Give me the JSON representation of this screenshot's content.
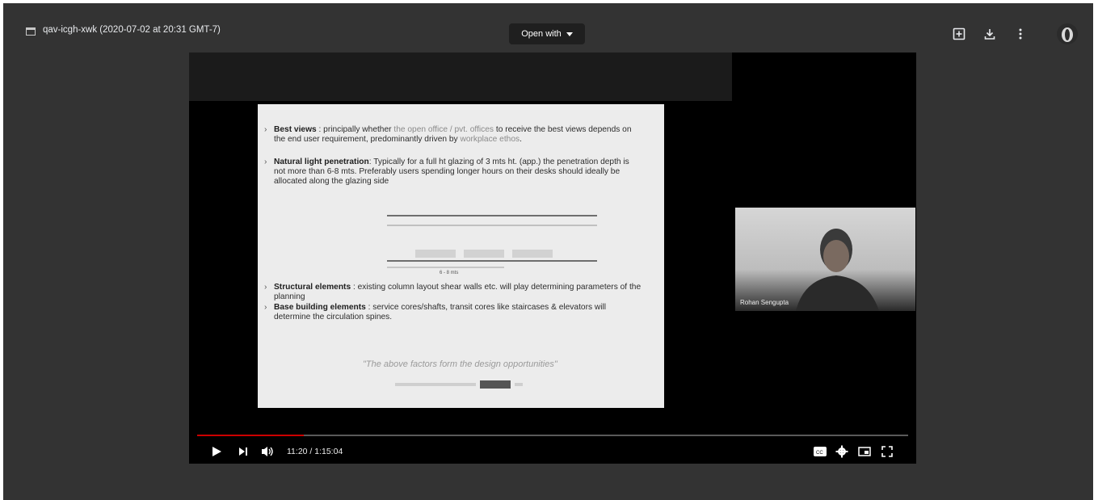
{
  "file": {
    "title": "qav-icgh-xwk (2020-07-02 at 20:31 GMT-7)"
  },
  "toolbar": {
    "open_with_label": "Open with"
  },
  "slide": {
    "bullet1_heading": "Best views",
    "bullet1_text_a": " : principally whether ",
    "bullet1_highlight_a": "the open office / pvt. offices",
    "bullet1_text_b": " to receive the best views depends on the end user requirement, predominantly driven by ",
    "bullet1_highlight_b": "workplace ethos",
    "bullet1_end": ".",
    "bullet2_heading": "Natural light penetration",
    "bullet2_text": ": Typically for a full ht glazing of 3 mts ht. (app.) the penetration depth is not more than 6-8 mts. Preferably users spending longer hours on their desks should ideally be allocated along the glazing side",
    "diagram_label": "6 - 8 mts",
    "bullet3_heading": "Structural elements",
    "bullet3_text": " : existing column layout shear walls etc. will play determining parameters of the planning",
    "bullet4_heading": "Base building elements",
    "bullet4_text": " : service cores/shafts, transit cores like staircases & elevators will determine the circulation spines.",
    "quote": "\"The above factors form the design opportunities\""
  },
  "webcam": {
    "participant_name": "Rohan Sengupta"
  },
  "player": {
    "time_display": "11:20 / 1:15:04",
    "progress_fraction": 0.15
  },
  "colors": {
    "viewer_bg": "#333333",
    "player_bg": "#000000",
    "progress_played": "#cc0000",
    "slide_bg": "#ececec"
  },
  "icons": {
    "file": "file-icon",
    "add_to_drive": "add-to-drive-icon",
    "download": "download-icon",
    "more": "more-vert-icon",
    "play": "play-icon",
    "next": "skip-next-icon",
    "volume": "volume-icon",
    "captions": "captions-icon",
    "settings": "gear-icon",
    "miniplayer": "miniplayer-icon",
    "fullscreen": "fullscreen-icon"
  }
}
